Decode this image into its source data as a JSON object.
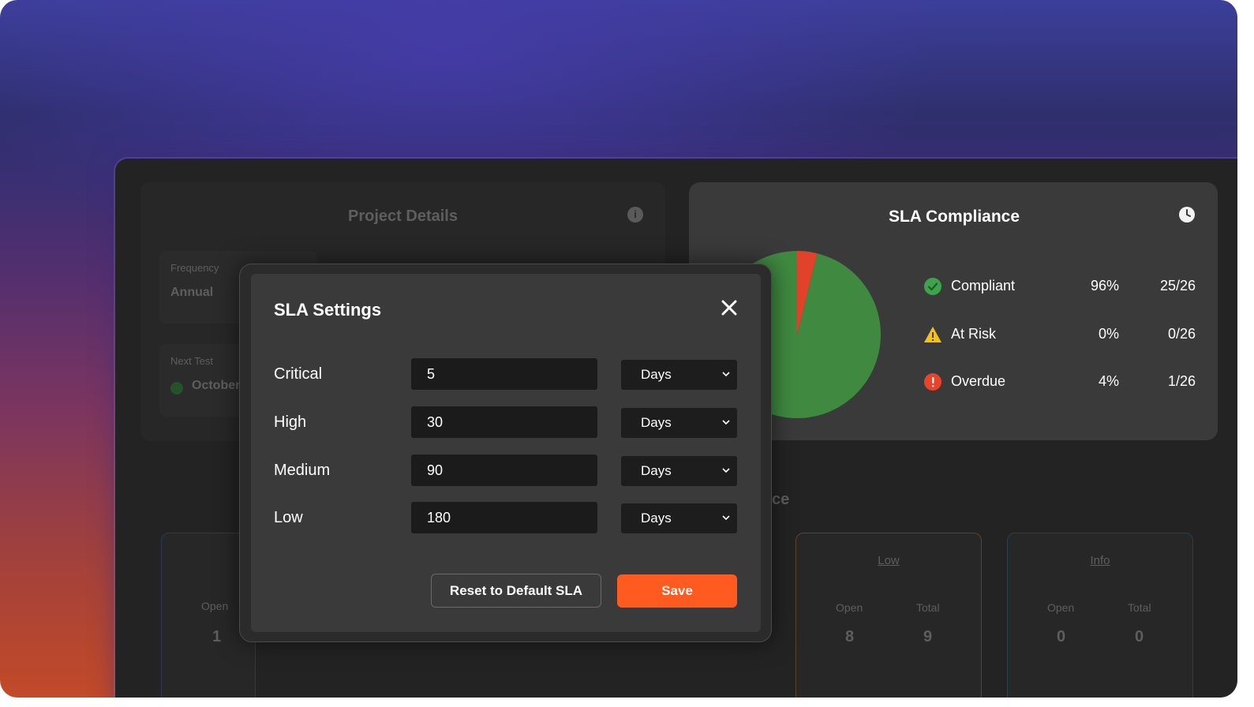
{
  "project_details": {
    "title": "Project Details",
    "frequency_label": "Frequency",
    "frequency_value": "Annual",
    "next_test_label": "Next Test",
    "next_test_value": "October"
  },
  "sla_compliance": {
    "title": "SLA Compliance",
    "rows": [
      {
        "name": "Compliant",
        "pct": "96%",
        "count": "25/26",
        "icon": "check-circle-icon",
        "color": "#3fa34d"
      },
      {
        "name": "At Risk",
        "pct": "0%",
        "count": "0/26",
        "icon": "warning-triangle-icon",
        "color": "#f2c21b"
      },
      {
        "name": "Overdue",
        "pct": "4%",
        "count": "1/26",
        "icon": "alert-circle-icon",
        "color": "#e8432b"
      }
    ]
  },
  "chart_data": {
    "type": "pie",
    "categories": [
      "Compliant",
      "At Risk",
      "Overdue"
    ],
    "values": [
      25,
      0,
      1
    ],
    "colors": [
      "#3f8a40",
      "#f2c21b",
      "#e0432a"
    ]
  },
  "severity_section": {
    "title_suffix": "ce",
    "cards": [
      {
        "title": "Low",
        "open_label": "Open",
        "total_label": "Total",
        "open": "8",
        "total": "9"
      },
      {
        "title": "Info",
        "open_label": "Open",
        "total_label": "Total",
        "open": "0",
        "total": "0"
      }
    ],
    "left_card": {
      "open_label": "Open",
      "open": "1"
    }
  },
  "modal": {
    "title": "SLA Settings",
    "rows": [
      {
        "label": "Critical",
        "value": "5",
        "unit": "Days"
      },
      {
        "label": "High",
        "value": "30",
        "unit": "Days"
      },
      {
        "label": "Medium",
        "value": "90",
        "unit": "Days"
      },
      {
        "label": "Low",
        "value": "180",
        "unit": "Days"
      }
    ],
    "reset_label": "Reset to Default SLA",
    "save_label": "Save"
  }
}
